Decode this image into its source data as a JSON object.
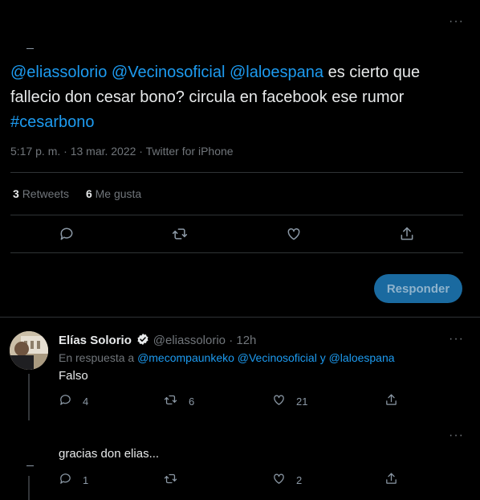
{
  "main_tweet": {
    "more": "···",
    "text_mentions": [
      "@eliassolorio",
      "@Vecinosoficial",
      "@laloespana"
    ],
    "text_body": "es cierto que fallecio don cesar bono? circula en facebook ese rumor",
    "hashtag": "#cesarbono",
    "timestamp": "5:17 p. m. · 13 mar. 2022 · Twitter for iPhone",
    "retweets_count": "3",
    "retweets_label": "Retweets",
    "likes_count": "6",
    "likes_label": "Me gusta"
  },
  "composer": {
    "reply_label": "Responder"
  },
  "reply1": {
    "name": "Elías Solorio",
    "handle": "@eliassolorio · 12h",
    "more": "···",
    "replying_prefix": "En respuesta a",
    "replying_to": "@mecompaunkeko @Vecinosoficial y @laloespana",
    "text": "Falso",
    "reply_count": "4",
    "retweet_count": "6",
    "like_count": "21"
  },
  "reply2": {
    "more": "···",
    "text": "gracias don elias...",
    "reply_count": "1",
    "like_count": "2"
  },
  "colors": {
    "accent": "#1d9bf0",
    "background": "#000000",
    "muted": "#71767b",
    "verified": "#e7e9ea"
  },
  "icons": [
    "reply-icon",
    "retweet-icon",
    "like-icon",
    "share-icon",
    "verified-icon",
    "more-icon"
  ]
}
